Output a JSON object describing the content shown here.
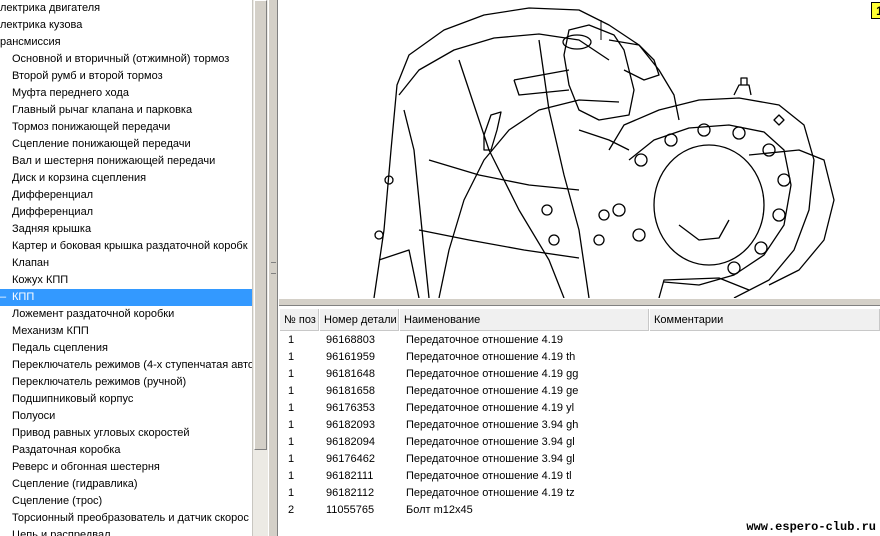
{
  "tree": {
    "items": [
      {
        "label": "лектрика двигателя",
        "level": 0,
        "selected": false
      },
      {
        "label": "лектрика кузова",
        "level": 0,
        "selected": false
      },
      {
        "label": "рансмиссия",
        "level": 0,
        "selected": false
      },
      {
        "label": "Основной и вторичный (отжимной) тормоз",
        "level": 1,
        "selected": false
      },
      {
        "label": "Второй румб и второй тормоз",
        "level": 1,
        "selected": false
      },
      {
        "label": "Муфта переднего хода",
        "level": 1,
        "selected": false
      },
      {
        "label": "Главный рычаг клапана и парковка",
        "level": 1,
        "selected": false
      },
      {
        "label": "Тормоз понижающей передачи",
        "level": 1,
        "selected": false
      },
      {
        "label": "Сцепление понижающей передачи",
        "level": 1,
        "selected": false
      },
      {
        "label": "Вал и шестерня понижающей передачи",
        "level": 1,
        "selected": false
      },
      {
        "label": "Диск и корзина сцепления",
        "level": 1,
        "selected": false
      },
      {
        "label": "Дифференциал",
        "level": 1,
        "selected": false
      },
      {
        "label": "Дифференциал",
        "level": 1,
        "selected": false
      },
      {
        "label": "Задняя крышка",
        "level": 1,
        "selected": false
      },
      {
        "label": "Картер и боковая крышка раздаточной коробк",
        "level": 1,
        "selected": false
      },
      {
        "label": "Клапан",
        "level": 1,
        "selected": false
      },
      {
        "label": "Кожух КПП",
        "level": 1,
        "selected": false
      },
      {
        "label": "КПП",
        "level": 1,
        "selected": true
      },
      {
        "label": "Ложемент раздаточной коробки",
        "level": 1,
        "selected": false
      },
      {
        "label": "Механизм КПП",
        "level": 1,
        "selected": false
      },
      {
        "label": "Педаль сцепления",
        "level": 1,
        "selected": false
      },
      {
        "label": "Переключатель режимов (4-х ступенчатая авто",
        "level": 1,
        "selected": false
      },
      {
        "label": "Переключатель режимов (ручной)",
        "level": 1,
        "selected": false
      },
      {
        "label": "Подшипниковый корпус",
        "level": 1,
        "selected": false
      },
      {
        "label": "Полуоси",
        "level": 1,
        "selected": false
      },
      {
        "label": "Привод равных угловых скоростей",
        "level": 1,
        "selected": false
      },
      {
        "label": "Раздаточная коробка",
        "level": 1,
        "selected": false
      },
      {
        "label": "Реверс и обгонная шестерня",
        "level": 1,
        "selected": false
      },
      {
        "label": "Сцепление (гидравлика)",
        "level": 1,
        "selected": false
      },
      {
        "label": "Сцепление (трос)",
        "level": 1,
        "selected": false
      },
      {
        "label": "Торсионный преобразователь и датчик скорос",
        "level": 1,
        "selected": false
      },
      {
        "label": "Цепь и распредвал",
        "level": 1,
        "selected": false
      }
    ]
  },
  "drawing": {
    "callout_label": "1"
  },
  "table": {
    "headers": [
      "№ поз",
      "Номер детали",
      "Наименование",
      "Комментарии"
    ],
    "rows": [
      [
        "1",
        "96168803",
        "Передаточное отношение 4.19",
        ""
      ],
      [
        "1",
        "96161959",
        "Передаточное отношение 4.19 th",
        ""
      ],
      [
        "1",
        "96181648",
        "Передаточное отношение 4.19 gg",
        ""
      ],
      [
        "1",
        "96181658",
        "Передаточное отношение 4.19  ge",
        ""
      ],
      [
        "1",
        "96176353",
        "Передаточное отношение 4.19  yl",
        ""
      ],
      [
        "1",
        "96182093",
        "Передаточное отношение 3.94 gh",
        ""
      ],
      [
        "1",
        "96182094",
        "Передаточное отношение 3.94 gl",
        ""
      ],
      [
        "1",
        "96176462",
        "Передаточное отношение 3.94 gl",
        ""
      ],
      [
        "1",
        "96182111",
        "Передаточное отношение 4.19 tl",
        ""
      ],
      [
        "1",
        "96182112",
        "Передаточное отношение 4.19 tz",
        ""
      ],
      [
        "2",
        "11055765",
        "Болт m12x45",
        ""
      ]
    ]
  },
  "watermark": "www.espero-club.ru",
  "colors": {
    "selection": "#3399ff",
    "callout": "#ffff33",
    "chrome": "#d4d0c8"
  }
}
